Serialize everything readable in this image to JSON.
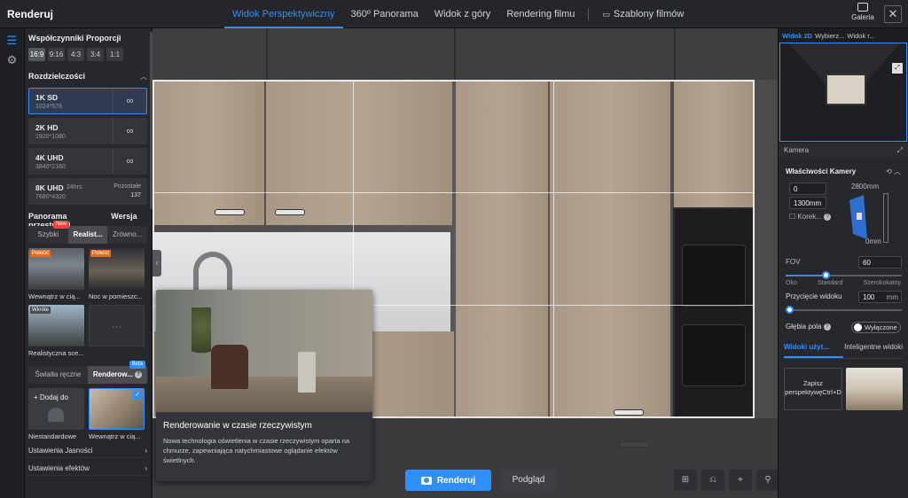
{
  "app": {
    "title": "Renderuj"
  },
  "topbar": {
    "tabs": [
      {
        "label": "Widok Perspektywiczny"
      },
      {
        "label": "360º Panorama"
      },
      {
        "label": "Widok z góry"
      },
      {
        "label": "Rendering filmu"
      }
    ],
    "templates_label": "Szablony filmów",
    "gallery_label": "Galeria",
    "close_label": "✕"
  },
  "left": {
    "ratio_title": "Współczynniki Proporcji",
    "ratios": [
      "16:9",
      "9:16",
      "4:3",
      "3:4",
      "1:1"
    ],
    "resolution_title": "Rozdzielczości",
    "resolutions": [
      {
        "name": "1K SD",
        "dims": "1024*576",
        "icon": "∞"
      },
      {
        "name": "2K HD",
        "dims": "1920*1080",
        "icon": "∞"
      },
      {
        "name": "4K UHD",
        "dims": "3840*2160",
        "icon": "∞"
      },
      {
        "name": "8K UHD",
        "dims": "7680*4320",
        "hours": "24hrs",
        "remaining_label": "Pozostałe",
        "remaining": "137"
      }
    ],
    "panorama_title": "Panorama przestrzeni",
    "version_label": "Wersja",
    "modes": [
      "Szybki",
      "Realist...",
      "Zrówno..."
    ],
    "new_badge": "New",
    "scenes": [
      {
        "label": "Wewnątrz w cią...",
        "badge": "Polecić"
      },
      {
        "label": "Noc w pomieszc...",
        "badge": "Polecić"
      },
      {
        "label": "Realistyczna sce...",
        "badge": "Wkróte"
      },
      {
        "label": "",
        "badge": "",
        "placeholder": "···"
      }
    ],
    "lighting_modes": [
      "Światła ręczne",
      "Renderow..."
    ],
    "beta_badge": "Beta",
    "help_icon": "?",
    "lights": [
      {
        "label": "Niestandardowe",
        "add_label": "+ Dodaj do"
      },
      {
        "label": "Wewnątrz w cią..."
      }
    ],
    "menu": [
      {
        "label": "Ustawienia Jasności"
      },
      {
        "label": "Ustawienia efektów"
      }
    ]
  },
  "tooltip": {
    "title": "Renderowanie w czasie rzeczywistym",
    "desc": "Nowa technologia oświetlenia w czasie rzeczywistym oparta na chmurze, zapewniająca natychmiastowe oglądanie efektów świetlnych."
  },
  "bottom": {
    "render_label": "Renderuj",
    "preview_label": "Podgląd"
  },
  "right": {
    "tab_2d": "Widok 2D",
    "tab_select": "Wybierz...",
    "tab_view": "Widok r...",
    "camera_section": "Kamera",
    "camera_props": "Właściwości Kamery",
    "pos_value": "0",
    "height_value": "1300mm",
    "top_mm": "2800mm",
    "bottom_mm": "0mm",
    "correction_label": "Korek...",
    "fov_label": "FOV",
    "fov_value": "60",
    "fov_fraction": 0.34,
    "ticks": [
      "Oko",
      "Standard",
      "Szerokokatny"
    ],
    "clip_label": "Przycięcie widoku",
    "clip_value": "100",
    "clip_unit": "mm",
    "clip_fraction": 0.02,
    "dof_label": "Głębia pola",
    "dof_state": "Wyłączone",
    "views_tabs": [
      "Widoki użyt...",
      "Inteligentne widoki"
    ],
    "save_perspective": "Zapisz perspektywęCtrl+D"
  }
}
